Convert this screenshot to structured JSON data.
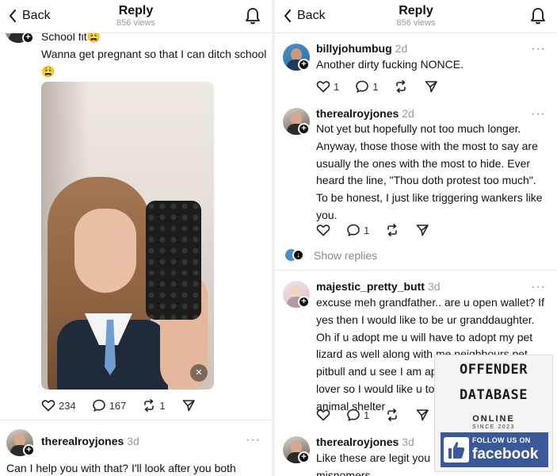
{
  "header": {
    "back_label": "Back",
    "title": "Reply",
    "views": "856 views"
  },
  "left": {
    "top_post": {
      "line1": "School fit",
      "line2": "Wanna get pregnant so that I can ditch school",
      "emoji": "😩",
      "actions": {
        "likes": "234",
        "replies": "167",
        "reposts": "1"
      }
    },
    "reply": {
      "username": "therealroyjones",
      "time": "3d",
      "text": "Can I help you with that? I'll look after you both"
    }
  },
  "right": {
    "posts": [
      {
        "username": "billyjohumbug",
        "time": "2d",
        "lines": [
          "Another dirty fucking NONCE."
        ],
        "likes": "1",
        "replies": "1"
      },
      {
        "username": "therealroyjones",
        "time": "2d",
        "lines": [
          "Not yet but hopefully not too much longer.",
          "Anyway, those those with the most to say are",
          "usually the ones with the most to hide. Ever",
          "heard the line, \"Thou doth protest too much\".",
          "To be honest, I just like triggering wankers like",
          "you."
        ],
        "replies": "1"
      },
      {
        "username": "majestic_pretty_butt",
        "time": "3d",
        "lines": [
          "excuse meh grandfather.. are u open wallet? If",
          "yes then I would like to be ur granddaughter.",
          "Oh if u adopt me u will have to adopt my pet",
          "lizard as well along with me neighbours pet",
          "pitbull and u see I am ap",
          "lover so I would like u to",
          "animal shelter"
        ],
        "replies": "1"
      },
      {
        "username": "therealroyjones",
        "time": "3d",
        "lines": [
          "Like these are legit you",
          "misnomers"
        ]
      }
    ],
    "show_replies": "Show replies"
  },
  "ad": {
    "line1": "OFFENDER",
    "line2": "DATABASE",
    "online": "ONLINE",
    "since": "SINCE 2023",
    "follow": "FOLLOW US ON",
    "facebook": "facebook",
    "fb_color": "#3b5998"
  },
  "icons": [
    "chevron-left",
    "bell",
    "heart",
    "comment",
    "repost",
    "share",
    "plus",
    "mute",
    "thumbs-up"
  ]
}
